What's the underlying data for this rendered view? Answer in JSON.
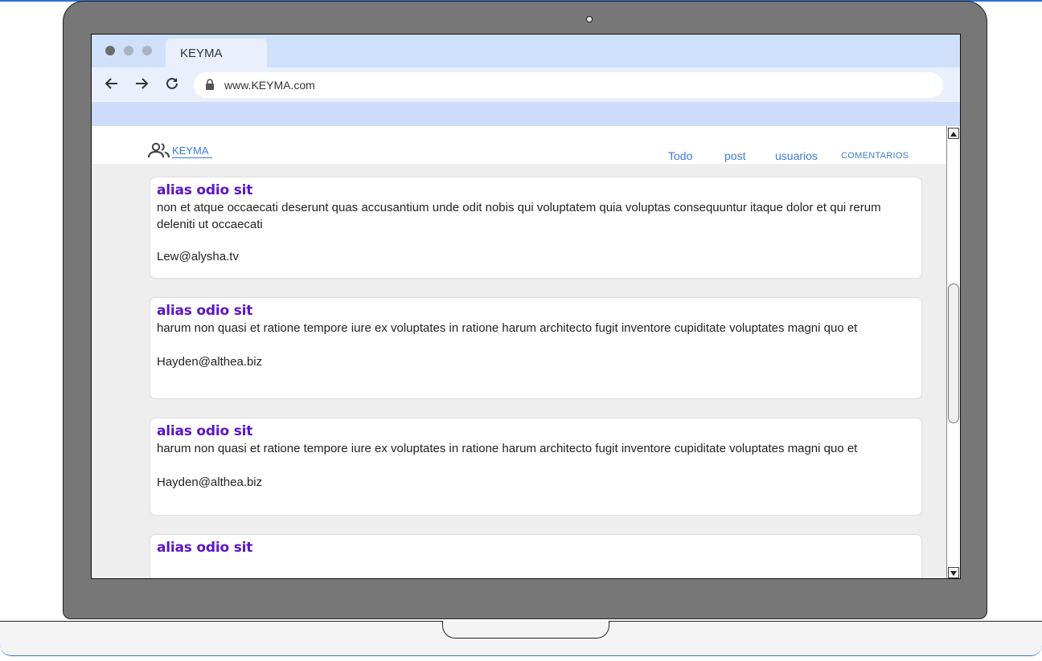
{
  "browser": {
    "tab_title": "KEYMA",
    "url": "www.KEYMA.com"
  },
  "site": {
    "brand": "KEYMA",
    "nav": [
      "Todo",
      "post",
      "usuarios",
      "COMENTARIOS"
    ]
  },
  "cards": [
    {
      "title": "alias odio sit",
      "body": "non et atque occaecati deserunt quas accusantium unde odit nobis qui voluptatem quia voluptas consequuntur itaque dolor et qui rerum deleniti ut occaecati",
      "email": "Lew@alysha.tv"
    },
    {
      "title": "alias odio sit",
      "body": "harum non quasi et ratione tempore iure ex voluptates in ratione harum architecto fugit inventore cupiditate voluptates magni quo et",
      "email": "Hayden@althea.biz"
    },
    {
      "title": "alias odio sit",
      "body": "harum non quasi et ratione tempore iure ex voluptates in ratione harum architecto fugit inventore cupiditate voluptates magni quo et",
      "email": "Hayden@althea.biz"
    },
    {
      "title": "alias odio sit",
      "body": "",
      "email": ""
    }
  ],
  "colors": {
    "accent": "#3b7bdc",
    "title": "#5a14c8",
    "tabbar": "#cfe0fb"
  }
}
